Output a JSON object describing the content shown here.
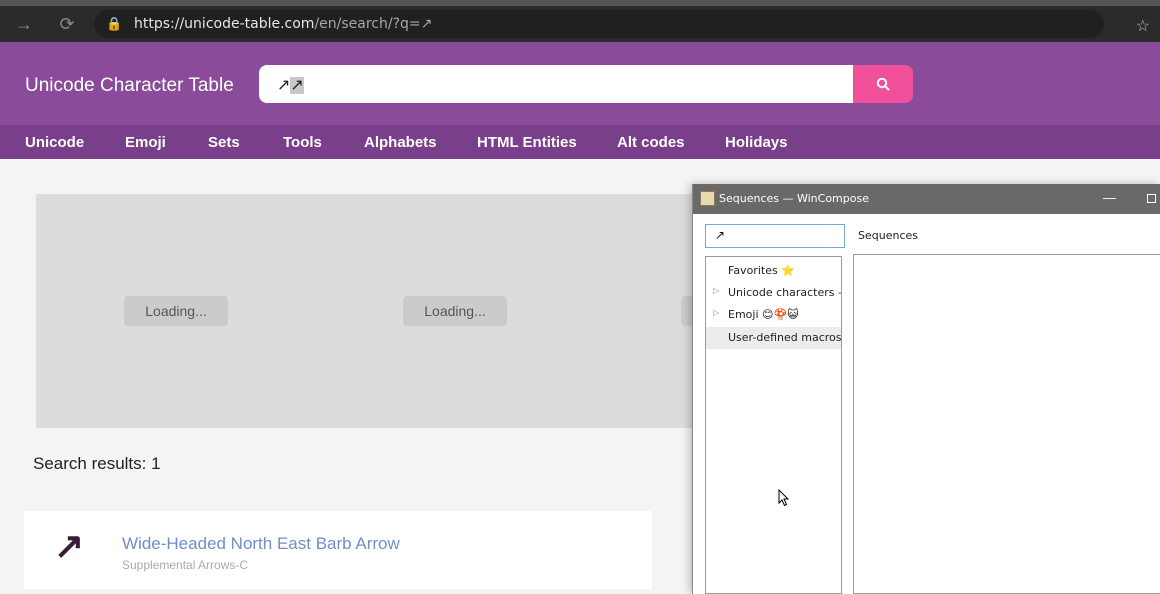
{
  "browser": {
    "url_host": "https://unicode-table.com",
    "url_path": "/en/search/?q=↗"
  },
  "site": {
    "title": "Unicode Character Table",
    "search_value_plain": "↗",
    "search_value_selected": "↗",
    "nav": [
      "Unicode",
      "Emoji",
      "Sets",
      "Tools",
      "Alphabets",
      "HTML Entities",
      "Alt codes",
      "Holidays"
    ],
    "loading_label": "Loading...",
    "results_count": "Search results: 1",
    "result": {
      "glyph": "↗",
      "name": "Wide-Headed North East Barb Arrow",
      "block": "Supplemental Arrows-C"
    },
    "colors": {
      "header": "#8a4b9a",
      "nav": "#7a3f8a",
      "search_button": "#f0509a",
      "link": "#6f8fc6"
    }
  },
  "wincompose": {
    "title": "Sequences — WinCompose",
    "search_value": "↗",
    "sequences_header": "Sequences",
    "tree": [
      {
        "label": "Favorites ⭐",
        "has_arrow": false
      },
      {
        "label": "Unicode characters —",
        "has_arrow": true
      },
      {
        "label": "Emoji 😊🍄😺",
        "has_arrow": true
      },
      {
        "label": "User-defined macros (",
        "has_arrow": false,
        "selected": true
      }
    ]
  }
}
